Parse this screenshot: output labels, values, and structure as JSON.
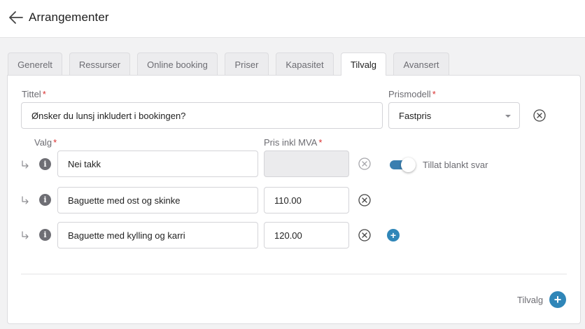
{
  "header": {
    "title": "Arrangementer",
    "back_icon": "arrow-left-icon"
  },
  "tabs": [
    {
      "label": "Generelt",
      "active": false
    },
    {
      "label": "Ressurser",
      "active": false
    },
    {
      "label": "Online booking",
      "active": false
    },
    {
      "label": "Priser",
      "active": false
    },
    {
      "label": "Kapasitet",
      "active": false
    },
    {
      "label": "Tilvalg",
      "active": true
    },
    {
      "label": "Avansert",
      "active": false
    }
  ],
  "form": {
    "title_label": "Tittel",
    "title_value": "Ønsker du lunsj inkludert i bookingen?",
    "price_model_label": "Prismodell",
    "price_model_value": "Fastpris",
    "required_mark": "*",
    "choice_label": "Valg",
    "price_label": "Pris inkl MVA",
    "choices": [
      {
        "name": "Nei takk",
        "price": ""
      },
      {
        "name": "Baguette med ost og skinke",
        "price": "110.00"
      },
      {
        "name": "Baguette med kylling og karri",
        "price": "120.00"
      }
    ],
    "allow_blank_label": "Tillat blankt svar",
    "allow_blank_on": true,
    "add_option_label": "Tilvalg"
  },
  "colors": {
    "accent": "#2f86b8",
    "required": "#d93030",
    "toggle": "#3a7fb0"
  }
}
